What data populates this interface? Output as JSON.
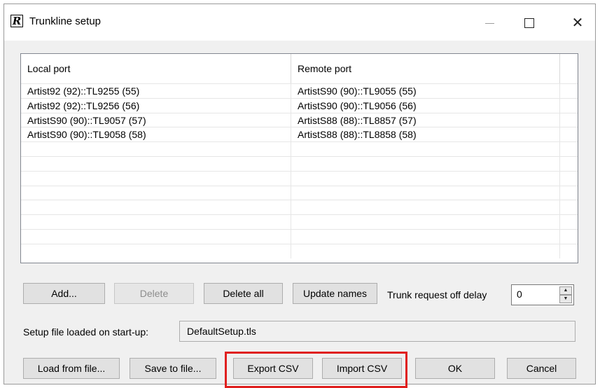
{
  "window": {
    "title": "Trunkline setup",
    "app_icon_letter": "R",
    "controls": {
      "minimize": "minimize",
      "maximize": "maximize",
      "close": "✕"
    }
  },
  "table": {
    "columns": [
      "Local port",
      "Remote port",
      ""
    ],
    "rows": [
      [
        "Artist92 (92)::TL9255 (55)",
        "ArtistS90 (90)::TL9055 (55)"
      ],
      [
        "Artist92 (92)::TL9256 (56)",
        "ArtistS90 (90)::TL9056 (56)"
      ],
      [
        "ArtistS90 (90)::TL9057 (57)",
        "ArtistS88 (88)::TL8857 (57)"
      ],
      [
        "ArtistS90 (90)::TL9058 (58)",
        "ArtistS88 (88)::TL8858 (58)"
      ],
      [
        "",
        ""
      ],
      [
        "",
        ""
      ],
      [
        "",
        ""
      ],
      [
        "",
        ""
      ],
      [
        "",
        ""
      ],
      [
        "",
        ""
      ],
      [
        "",
        ""
      ],
      [
        "",
        ""
      ]
    ]
  },
  "buttons": {
    "add": "Add...",
    "delete": "Delete",
    "delete_all": "Delete all",
    "update_names": "Update names",
    "load_from_file": "Load from file...",
    "save_to_file": "Save to file...",
    "export_csv": "Export CSV",
    "import_csv": "Import CSV",
    "ok": "OK",
    "cancel": "Cancel"
  },
  "trunk_delay": {
    "label": "Trunk request off delay",
    "value": "0"
  },
  "setup_file": {
    "label": "Setup file loaded on start-up:",
    "value": "DefaultSetup.tls"
  },
  "colors": {
    "highlight": "#e0201f",
    "window_bg": "#f0f0f0",
    "table_bg": "#ffffff"
  }
}
